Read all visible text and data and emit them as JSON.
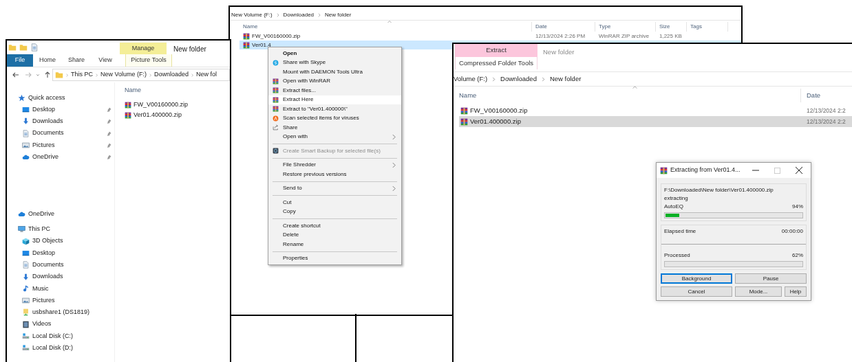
{
  "left_window": {
    "context_tab": {
      "label": "Manage",
      "sublabel": "Picture Tools"
    },
    "title": "New folder",
    "ribbon_tabs": [
      {
        "label": "File",
        "kind": "file"
      },
      {
        "label": "Home",
        "kind": "tab"
      },
      {
        "label": "Share",
        "kind": "tab"
      },
      {
        "label": "View",
        "kind": "tab"
      }
    ],
    "breadcrumb": [
      "This PC",
      "New Volume (F:)",
      "Downloaded",
      "New fol"
    ],
    "nav": [
      {
        "label": "Quick access",
        "kind": "star",
        "children": [
          {
            "label": "Desktop",
            "kind": "desktop",
            "pinned": true
          },
          {
            "label": "Downloads",
            "kind": "download",
            "pinned": true
          },
          {
            "label": "Documents",
            "kind": "document",
            "pinned": true
          },
          {
            "label": "Pictures",
            "kind": "picture",
            "pinned": true
          },
          {
            "label": "OneDrive",
            "kind": "cloud",
            "pinned": true
          }
        ]
      },
      {
        "label": "OneDrive",
        "kind": "cloud"
      },
      {
        "label": "This PC",
        "kind": "pc",
        "children": [
          {
            "label": "3D Objects",
            "kind": "cube"
          },
          {
            "label": "Desktop",
            "kind": "desktop"
          },
          {
            "label": "Documents",
            "kind": "document"
          },
          {
            "label": "Downloads",
            "kind": "download"
          },
          {
            "label": "Music",
            "kind": "music"
          },
          {
            "label": "Pictures",
            "kind": "picture"
          },
          {
            "label": "usbshare1 (DS1819)",
            "kind": "netdrive"
          },
          {
            "label": "Videos",
            "kind": "video"
          },
          {
            "label": "Local Disk (C:)",
            "kind": "disk"
          },
          {
            "label": "Local Disk (D:)",
            "kind": "disk"
          }
        ]
      }
    ],
    "column": "Name",
    "files": [
      {
        "name": "FW_V00160000.zip",
        "selected": false
      },
      {
        "name": "Ver01.400000.zip",
        "selected": false
      }
    ]
  },
  "middle_window": {
    "breadcrumb": [
      "New Volume (F:)",
      "Downloaded",
      "New folder"
    ],
    "columns": [
      "Name",
      "Date",
      "Type",
      "Size",
      "Tags"
    ],
    "rows": [
      {
        "name": "FW_V00160000.zip",
        "date": "12/13/2024 2:26 PM",
        "type": "WinRAR ZIP archive",
        "size": "1,225 KB",
        "selected": false
      },
      {
        "name": "Ver01.4",
        "selected": true
      }
    ]
  },
  "context_menu": {
    "groups": [
      [
        {
          "label": "Open",
          "kind": "none",
          "bold": true,
          "submenu": false,
          "disabled": false,
          "selected": false
        },
        {
          "label": "Share with Skype",
          "kind": "skype",
          "bold": false,
          "submenu": false,
          "disabled": false,
          "selected": false
        },
        {
          "label": "Mount with DAEMON Tools Ultra",
          "kind": "none",
          "bold": false,
          "submenu": false,
          "disabled": false,
          "selected": false
        },
        {
          "label": "Open with WinRAR",
          "kind": "winrar",
          "bold": false,
          "submenu": false,
          "disabled": false,
          "selected": false
        },
        {
          "label": "Extract files...",
          "kind": "winrar",
          "bold": false,
          "submenu": false,
          "disabled": false,
          "selected": false
        },
        {
          "label": "Extract Here",
          "kind": "winrar",
          "bold": false,
          "submenu": false,
          "disabled": false,
          "selected": true
        },
        {
          "label": "Extract to \"Ver01.400000\\\"",
          "kind": "winrar",
          "bold": false,
          "submenu": false,
          "disabled": false,
          "selected": false
        },
        {
          "label": "Scan selected items for viruses",
          "kind": "avast",
          "bold": false,
          "submenu": false,
          "disabled": false,
          "selected": false
        },
        {
          "label": "Share",
          "kind": "share",
          "bold": false,
          "submenu": false,
          "disabled": false,
          "selected": false
        },
        {
          "label": "Open with",
          "kind": "none",
          "bold": false,
          "submenu": true,
          "disabled": false,
          "selected": false
        }
      ],
      [
        {
          "label": "Create Smart Backup for selected file(s)",
          "kind": "daemon",
          "bold": false,
          "submenu": false,
          "disabled": true,
          "selected": false
        }
      ],
      [
        {
          "label": "File Shredder",
          "kind": "none",
          "bold": false,
          "submenu": true,
          "disabled": false,
          "selected": false
        },
        {
          "label": "Restore previous versions",
          "kind": "none",
          "bold": false,
          "submenu": false,
          "disabled": false,
          "selected": false
        }
      ],
      [
        {
          "label": "Send to",
          "kind": "none",
          "bold": false,
          "submenu": true,
          "disabled": false,
          "selected": false
        }
      ],
      [
        {
          "label": "Cut",
          "kind": "none",
          "bold": false,
          "submenu": false,
          "disabled": false,
          "selected": false
        },
        {
          "label": "Copy",
          "kind": "none",
          "bold": false,
          "submenu": false,
          "disabled": false,
          "selected": false
        }
      ],
      [
        {
          "label": "Create shortcut",
          "kind": "none",
          "bold": false,
          "submenu": false,
          "disabled": false,
          "selected": false
        },
        {
          "label": "Delete",
          "kind": "none",
          "bold": false,
          "submenu": false,
          "disabled": false,
          "selected": false
        },
        {
          "label": "Rename",
          "kind": "none",
          "bold": false,
          "submenu": false,
          "disabled": false,
          "selected": false
        }
      ],
      [
        {
          "label": "Properties",
          "kind": "none",
          "bold": false,
          "submenu": false,
          "disabled": false,
          "selected": false
        }
      ]
    ]
  },
  "right_window": {
    "context_tab": {
      "label": "Extract",
      "sublabel": "Compressed Folder Tools"
    },
    "title": "New folder",
    "breadcrumb": [
      "Volume (F:)",
      "Downloaded",
      "New folder"
    ],
    "columns": [
      "Name",
      "Date"
    ],
    "rows": [
      {
        "name": "FW_V00160000.zip",
        "date": "12/13/2024 2:2",
        "selected": false
      },
      {
        "name": "Ver01.400000.zip",
        "date": "12/13/2024 2:2",
        "selected": true
      }
    ]
  },
  "dialog": {
    "title": "Extracting from Ver01.4...",
    "path": "F:\\Downloaded\\New folder\\Ver01.400000.zip",
    "action": "extracting",
    "file": "AutoEQ",
    "file_percent": "94%",
    "file_progress": {
      "level": 0.1
    },
    "elapsed_label": "Elapsed time",
    "elapsed": "00:00:00",
    "processed_label": "Processed",
    "processed_percent": "62%",
    "processed_progress": {
      "level": 0
    },
    "buttons": [
      {
        "label": "Background",
        "focused": true
      },
      {
        "label": "Pause",
        "focused": false
      },
      {
        "label": "Cancel",
        "focused": false
      },
      {
        "label": "Mode...",
        "focused": false
      },
      {
        "label": "Help",
        "focused": false
      }
    ]
  }
}
